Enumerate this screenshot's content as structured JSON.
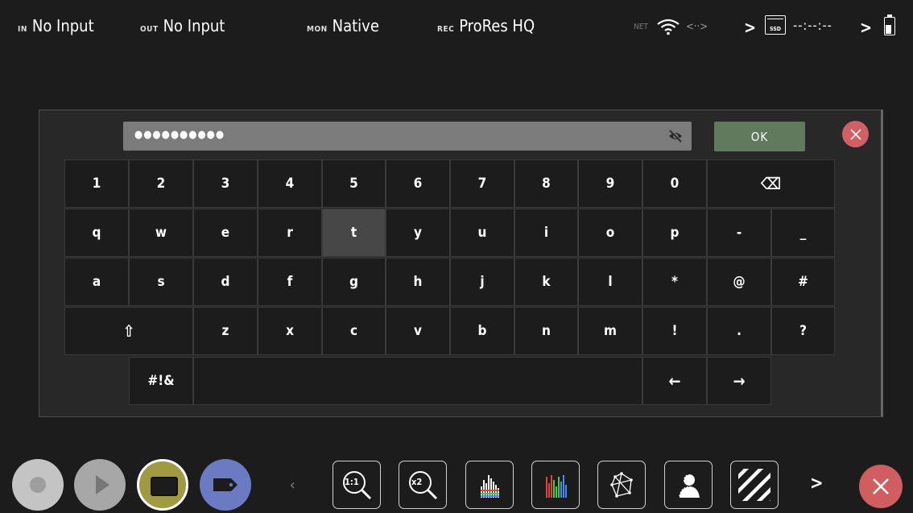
{
  "status": {
    "in_tag": "IN",
    "in_val": "No Input",
    "out_tag": "OUT",
    "out_val": "No Input",
    "mon_tag": "MON",
    "mon_val": "Native",
    "rec_tag": "REC",
    "rec_val": "ProRes HQ",
    "net_tag": "NET",
    "ethernet": "<··>",
    "chevron": ">",
    "ssd_label": "SSD",
    "timecode": "--:--:--",
    "chevron2": ">"
  },
  "keyboard": {
    "password_mask": "●●●●●●●●●●",
    "ok_label": "OK",
    "rows": [
      [
        "1",
        "2",
        "3",
        "4",
        "5",
        "6",
        "7",
        "8",
        "9",
        "0",
        "⌫"
      ],
      [
        "q",
        "w",
        "e",
        "r",
        "t",
        "y",
        "u",
        "i",
        "o",
        "p",
        "-",
        "_"
      ],
      [
        "a",
        "s",
        "d",
        "f",
        "g",
        "h",
        "j",
        "k",
        "l",
        "*",
        "@",
        "#"
      ],
      [
        "⇧",
        "z",
        "x",
        "c",
        "v",
        "b",
        "n",
        "m",
        "!",
        ".",
        "?"
      ],
      [
        "#!&",
        "",
        "←",
        "→"
      ]
    ],
    "active_key": "t"
  },
  "toolbar": {
    "prev": "‹",
    "next": ">",
    "zoom_1to1": "1:1",
    "zoom_x2": "x2"
  },
  "colors": {
    "ok_button": "#5f7a5c",
    "close_button": "#d05d60",
    "display_button": "#a09a42",
    "tag_button": "#6a7bc4"
  }
}
